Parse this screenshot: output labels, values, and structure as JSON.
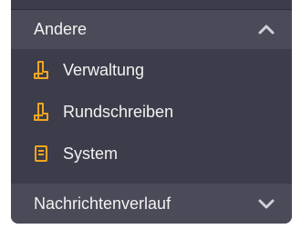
{
  "colors": {
    "panel_bg": "#3c3c4a",
    "header_bg": "#4a4a58",
    "text": "#f2f2f2",
    "icon_accent": "#f0a620",
    "chevron": "#cfcfd8"
  },
  "sections": [
    {
      "title": "Andere",
      "expanded": true,
      "chevron_icon": "chevron-up-icon",
      "items": [
        {
          "label": "Verwaltung",
          "icon": "flag-icon"
        },
        {
          "label": "Rundschreiben",
          "icon": "flag-icon"
        },
        {
          "label": "System",
          "icon": "document-icon"
        }
      ]
    },
    {
      "title": "Nachrichtenverlauf",
      "expanded": false,
      "chevron_icon": "chevron-down-icon"
    }
  ]
}
